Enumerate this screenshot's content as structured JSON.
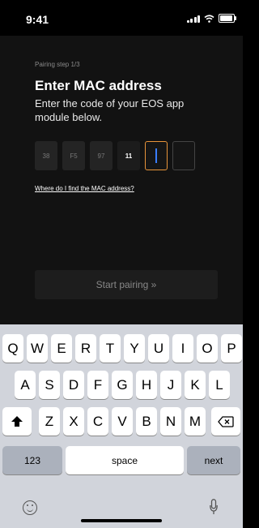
{
  "status_bar": {
    "time": "9:41",
    "signal_icon": "signal-bars-icon",
    "wifi_icon": "wifi-icon",
    "battery_icon": "battery-icon"
  },
  "pairing": {
    "step_label": "Pairing step 1/3",
    "title": "Enter MAC address",
    "subtitle": "Enter the code of your EOS app module  below.",
    "mac_fields": [
      "38",
      "F5",
      "97",
      "11",
      "",
      ""
    ],
    "help_link": "Where do I find the MAC address?",
    "start_button": "Start pairing »"
  },
  "keyboard": {
    "row1": [
      "Q",
      "W",
      "E",
      "R",
      "T",
      "Y",
      "U",
      "I",
      "O",
      "P"
    ],
    "row2": [
      "A",
      "S",
      "D",
      "F",
      "G",
      "H",
      "J",
      "K",
      "L"
    ],
    "row3": [
      "Z",
      "X",
      "C",
      "V",
      "B",
      "N",
      "M"
    ],
    "numbers_key": "123",
    "space_key": "space",
    "next_key": "next",
    "shift_icon": "shift-icon",
    "delete_icon": "delete-icon",
    "emoji_icon": "emoji-icon",
    "mic_icon": "microphone-icon"
  },
  "colors": {
    "accent": "#e8943a",
    "cursor": "#3a7dff",
    "background": "#121212"
  }
}
